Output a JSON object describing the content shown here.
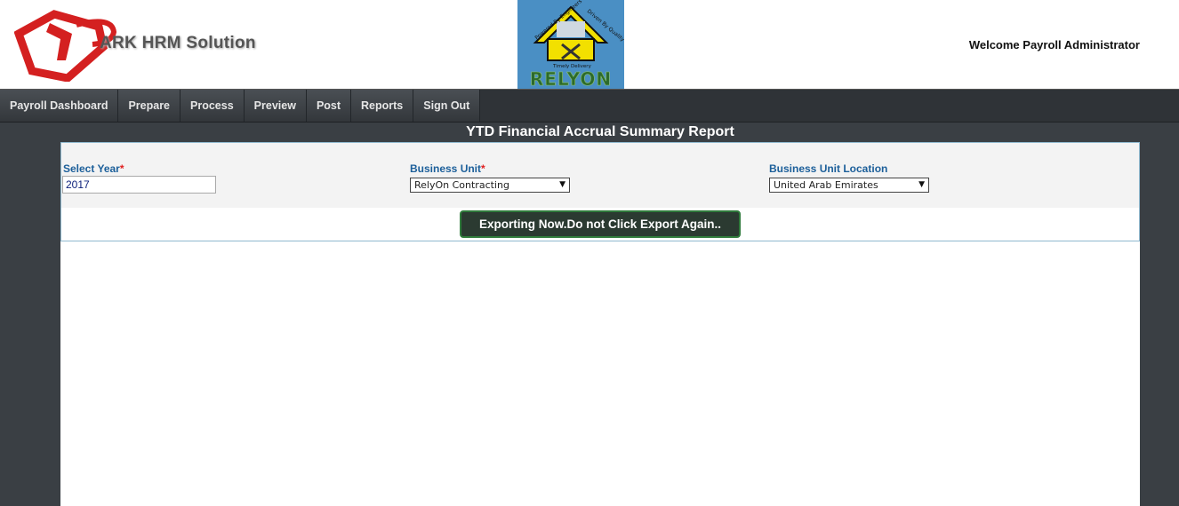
{
  "header": {
    "brand_name": "ARK HRM Solution",
    "partner_logo_text": "RELYON",
    "partner_logo_tagline_1": "Powered By Engineers",
    "partner_logo_tagline_2": "Driven By Quality",
    "partner_logo_tagline_3": "Timely Delivery",
    "welcome_text": "Welcome Payroll Administrator"
  },
  "nav": {
    "items": [
      {
        "label": "Payroll Dashboard"
      },
      {
        "label": "Prepare"
      },
      {
        "label": "Process"
      },
      {
        "label": "Preview"
      },
      {
        "label": "Post"
      },
      {
        "label": "Reports"
      },
      {
        "label": "Sign Out"
      }
    ]
  },
  "page": {
    "title": "YTD Financial Accrual Summary Report"
  },
  "form": {
    "year": {
      "label": "Select Year",
      "required_mark": "*",
      "value": "2017"
    },
    "business_unit": {
      "label": "Business Unit",
      "required_mark": "*",
      "value": "RelyOn Contracting"
    },
    "location": {
      "label": "Business Unit Location",
      "value": "United Arab Emirates"
    },
    "export_button_label": "Exporting Now.Do not Click Export Again.."
  },
  "colors": {
    "nav_bg": "#2f3337",
    "label_blue": "#1c5f9a",
    "required_red": "#e02020",
    "button_border_green": "#2f7a3b"
  }
}
